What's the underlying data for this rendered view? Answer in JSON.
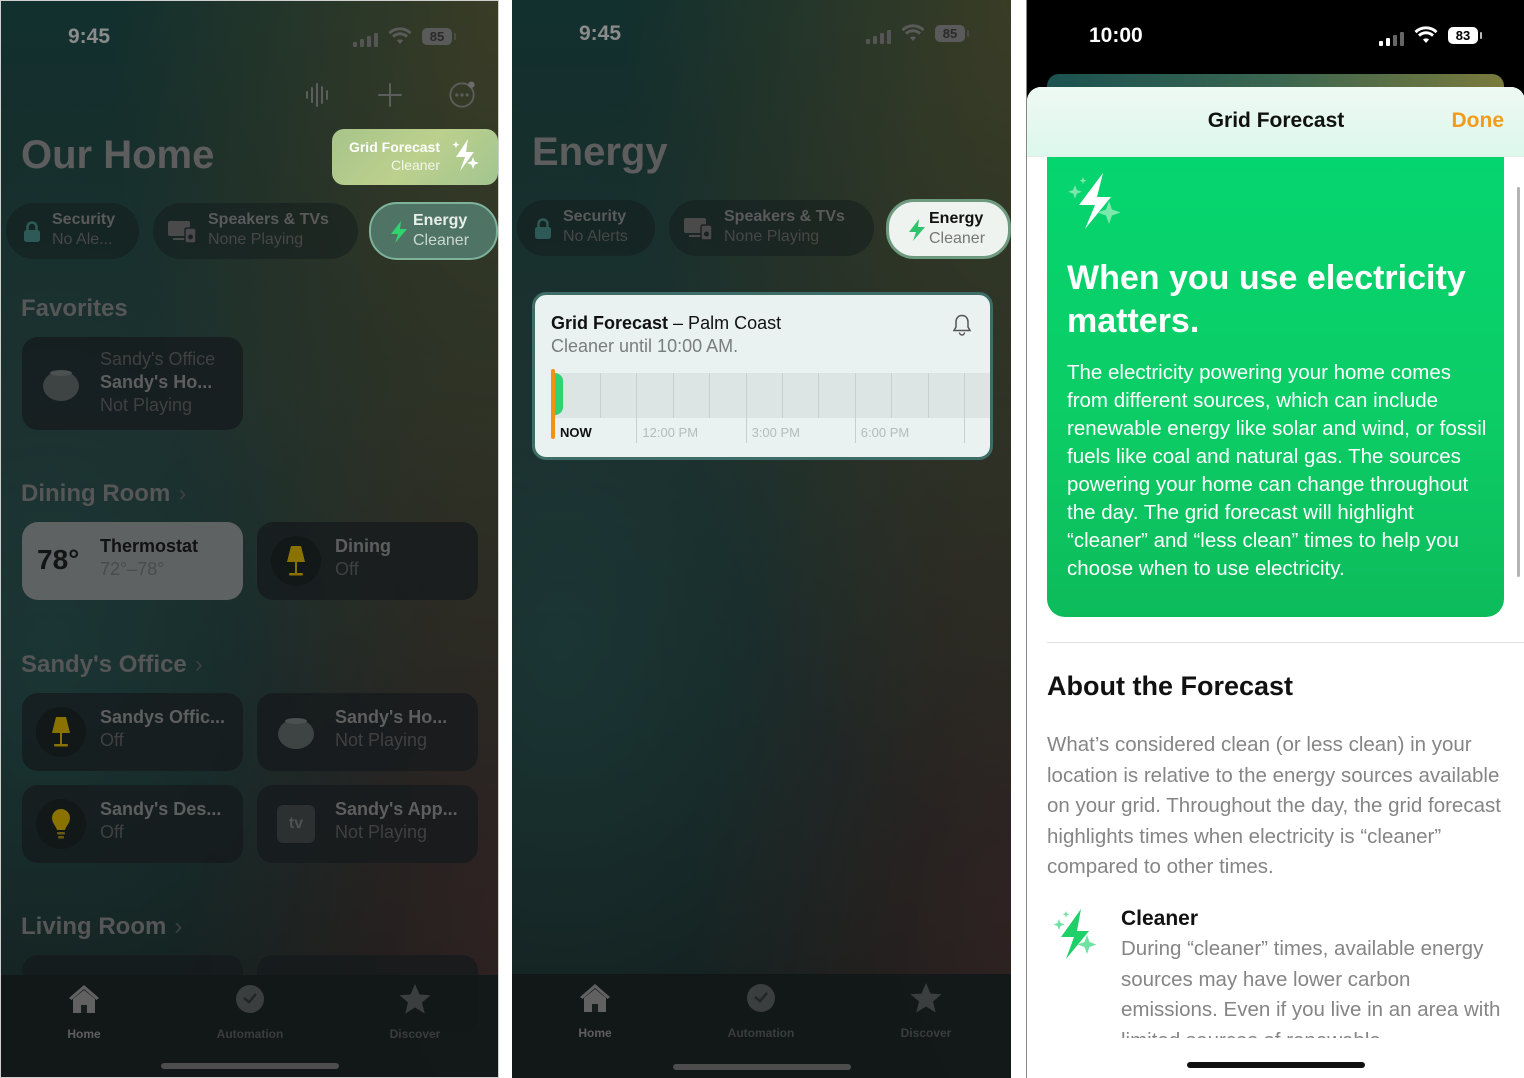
{
  "panel1": {
    "status": {
      "time": "9:45",
      "battery": "85"
    },
    "toolbar": {
      "icons": [
        "waveform-icon",
        "plus-icon",
        "more-icon"
      ]
    },
    "title": "Our Home",
    "grid_badge": {
      "title": "Grid Forecast",
      "status": "Cleaner"
    },
    "pills": [
      {
        "title": "Security",
        "subtitle": "No Ale...",
        "icon": "lock-icon"
      },
      {
        "title": "Speakers & TVs",
        "subtitle": "None Playing",
        "icon": "speakers-tv-icon"
      },
      {
        "title": "Energy",
        "subtitle": "Cleaner",
        "icon": "bolt-icon"
      }
    ],
    "favorites": {
      "heading": "Favorites",
      "tiles": [
        {
          "room": "Sandy's Office",
          "name": "Sandy's Ho...",
          "state": "Not Playing"
        }
      ]
    },
    "dining_room": {
      "heading": "Dining Room",
      "tiles": [
        {
          "value": "78°",
          "name": "Thermostat",
          "state": "72°–78°"
        },
        {
          "name": "Dining",
          "state": "Off"
        }
      ]
    },
    "sandys_office": {
      "heading": "Sandy's Office",
      "tiles": [
        {
          "name": "Sandys Offic...",
          "state": "Off"
        },
        {
          "name": "Sandy's Ho...",
          "state": "Not Playing"
        },
        {
          "name": "Sandy's Des...",
          "state": "Off"
        },
        {
          "name": "Sandy's App...",
          "state": "Not Playing",
          "icon_text": "tv"
        }
      ]
    },
    "living_room": {
      "heading": "Living Room"
    },
    "tabs": [
      {
        "label": "Home",
        "active": true
      },
      {
        "label": "Automation",
        "active": false
      },
      {
        "label": "Discover",
        "active": false
      }
    ]
  },
  "panel2": {
    "status": {
      "time": "9:45",
      "battery": "85"
    },
    "title": "Energy",
    "pills": [
      {
        "title": "Security",
        "subtitle": "No Alerts"
      },
      {
        "title": "Speakers & TVs",
        "subtitle": "None Playing"
      },
      {
        "title": "Energy",
        "subtitle": "Cleaner"
      }
    ],
    "forecast": {
      "title_bold": "Grid Forecast",
      "title_rest": " – Palm Coast",
      "subtitle": "Cleaner until 10:00 AM.",
      "timeline_labels": [
        "NOW",
        "12:00 PM",
        "3:00 PM",
        "6:00 PM"
      ],
      "cleaner_fraction_of_first_hour": 0.25
    },
    "tabs": [
      {
        "label": "Home",
        "active": true
      },
      {
        "label": "Automation",
        "active": false
      },
      {
        "label": "Discover",
        "active": false
      }
    ]
  },
  "panel3": {
    "status": {
      "time": "10:00",
      "battery": "83"
    },
    "sheet": {
      "title": "Grid Forecast",
      "done_label": "Done"
    },
    "hero": {
      "heading": "When you use electricity matters.",
      "body": "The electricity powering your home comes from different sources, which can include renewable energy like solar and wind, or fossil fuels like coal and natural gas. The sources powering your home can change throughout the day. The grid forecast will highlight “cleaner” and “less clean” times to help you choose when to use electricity."
    },
    "about": {
      "heading": "About the Forecast",
      "body": "What’s considered clean (or less clean) in your location is relative to the energy sources available on your grid. Throughout the day, the grid forecast highlights times when electricity is “cleaner” compared to other times."
    },
    "cleaner": {
      "heading": "Cleaner",
      "body": "During “cleaner” times, available energy sources may have lower carbon emissions. Even if you live in an area with limited sources of renewable"
    }
  },
  "colors": {
    "accent_green": "#05d56f",
    "done_orange": "#f39c1b",
    "now_marker": "#f2920e",
    "lamp_yellow": "#8a7200"
  }
}
